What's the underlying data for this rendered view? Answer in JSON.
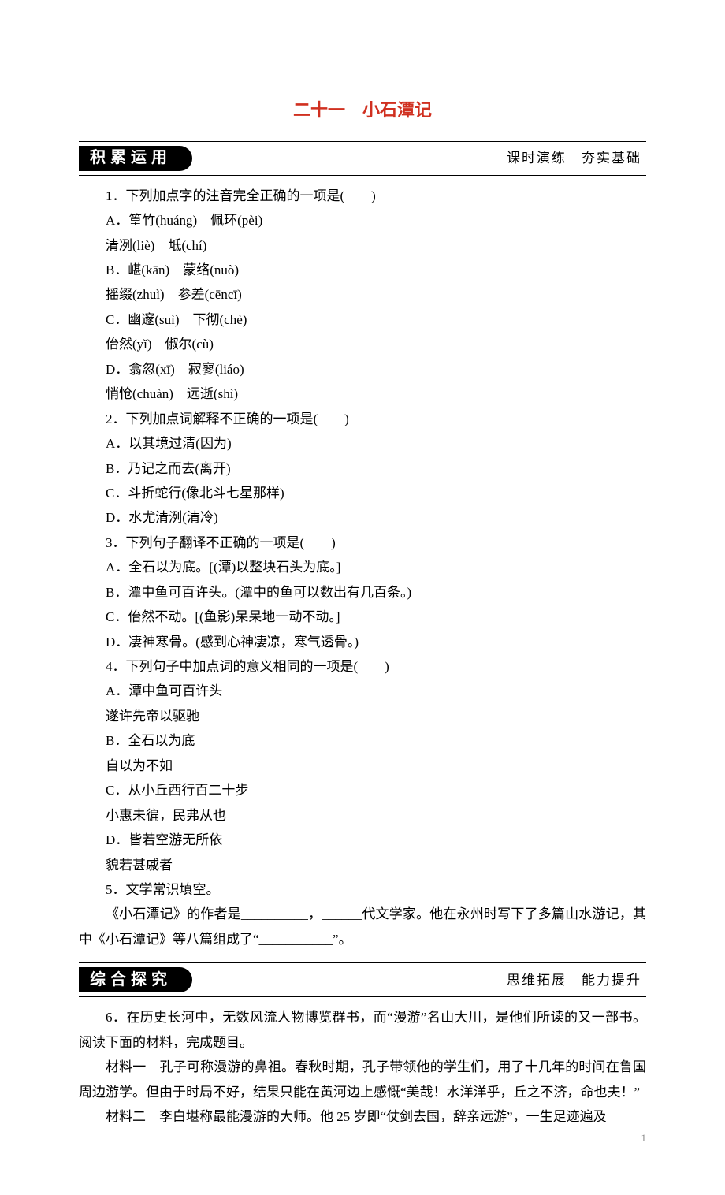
{
  "chapter_title": "二十一　小石潭记",
  "sections": [
    {
      "pill": "积累运用",
      "sub": "课时演练　夯实基础"
    },
    {
      "pill": "综合探究",
      "sub": "思维拓展　能力提升"
    }
  ],
  "q1": {
    "stem": "1．下列加点字的注音完全正确的一项是(　　)",
    "A1": "A．篁竹(huáng)　佩环(pèi)",
    "A2": "清冽(liè)　坻(chí)",
    "B1": "B．嵁(kān)　蒙络(nuò)",
    "B2": "摇缀(zhuì)　参差(cēncī)",
    "C1": "C．幽邃(suì)　下彻(chè)",
    "C2": "佁然(yǐ)　俶尔(cù)",
    "D1": "D．翕忽(xī)　寂寥(liáo)",
    "D2": "悄怆(chuàn)　远逝(shì)"
  },
  "q2": {
    "stem": "2．下列加点词解释不正确的一项是(　　)",
    "A": "A．以其境过清(因为)",
    "B": "B．乃记之而去(离开)",
    "C": "C．斗折蛇行(像北斗七星那样)",
    "D": "D．水尤清洌(清冷)"
  },
  "q3": {
    "stem": "3．下列句子翻译不正确的一项是(　　)",
    "A": "A．全石以为底。[(潭)以整块石头为底。]",
    "B": "B．潭中鱼可百许头。(潭中的鱼可以数出有几百条。)",
    "C": "C．佁然不动。[(鱼影)呆呆地一动不动。]",
    "D": "D．凄神寒骨。(感到心神凄凉，寒气透骨。)"
  },
  "q4": {
    "stem": "4．下列句子中加点词的意义相同的一项是(　　)",
    "A1": "A．潭中鱼可百许头",
    "A2": "遂许先帝以驱驰",
    "B1": "B．全石以为底",
    "B2": "自以为不如",
    "C1": "C．从小丘西行百二十步",
    "C2": "小惠未徧，民弗从也",
    "D1": "D．皆若空游无所依",
    "D2": "貌若甚戚者"
  },
  "q5": {
    "stem": "5．文学常识填空。",
    "line": "《小石潭记》的作者是__________，______代文学家。他在永州时写下了多篇山水游记，其中《小石潭记》等八篇组成了“___________”。"
  },
  "q6": {
    "stem": "6．在历史长河中，无数风流人物博览群书，而“漫游”名山大川，是他们所读的又一部书。阅读下面的材料，完成题目。",
    "m1": "材料一　孔子可称漫游的鼻祖。春秋时期，孔子带领他的学生们，用了十几年的时间在鲁国周边游学。但由于时局不好，结果只能在黄河边上感慨“美哉！水洋洋乎，丘之不济，命也夫！”",
    "m2": "材料二　李白堪称最能漫游的大师。他 25 岁即“仗剑去国，辞亲远游”，一生足迹遍及"
  },
  "page_number": "1"
}
